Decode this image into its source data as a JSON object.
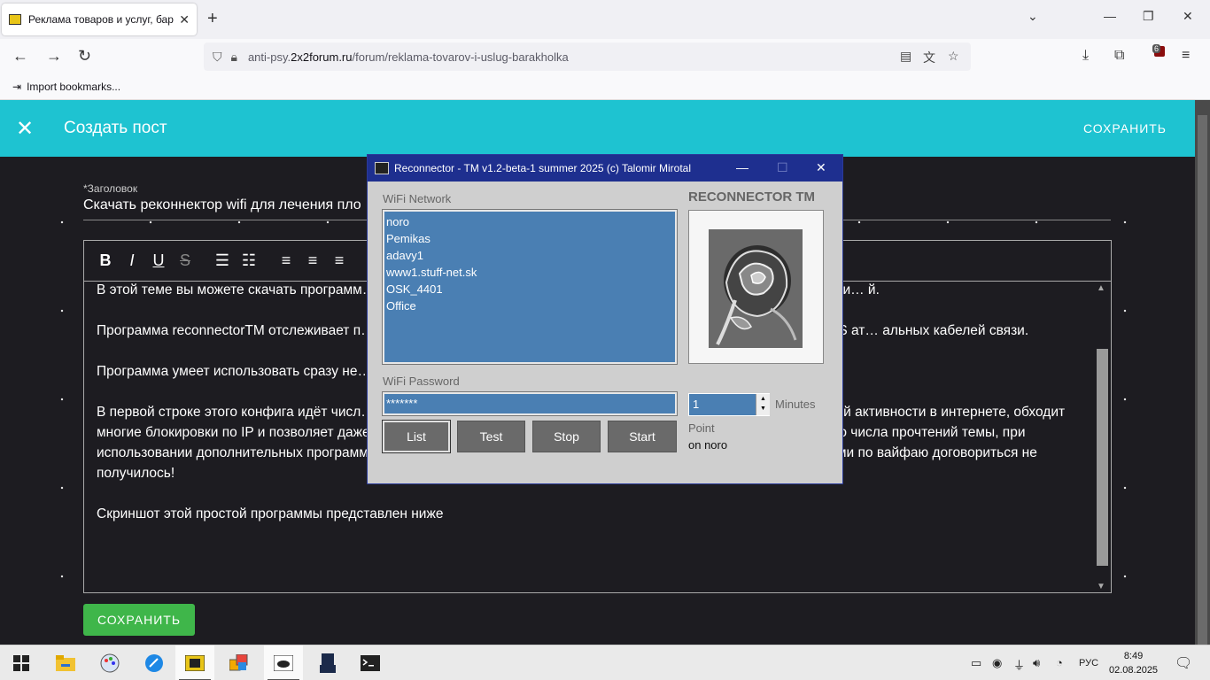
{
  "browser": {
    "tab_title": "Реклама товаров и услуг, бара",
    "url_prefix": "anti-psy.",
    "url_host": "2x2forum.ru",
    "url_path": "/forum/reklama-tovarov-i-uslug-barakholka",
    "bookmarks_import": "Import bookmarks...",
    "extension_badge": "6"
  },
  "appbar": {
    "title": "Создать пост",
    "save_label": "СОХРАНИТЬ"
  },
  "form": {
    "title_label": "*Заголовок",
    "title_value": "Скачать реконнектор wifi для лечения пло",
    "paragraphs": [
      "В этой теме вы можете скачать программ… екта в цикле при пропаже wifi на Windows. Также в этой теме могут публи… й.",
      "Программа reconnectorTM отслеживает п… й, в цикле, чтобы минимизировать неудобства при помехах, браке, DDoS ат… альных кабелей связи.",
      "Программа умеет использовать сразу не… пароль по одной в строке, начиная со второй строки файла config.txt",
      "В первой строке этого конфига идёт числ… ны IP адреса этим. Это уменьшает отслеживаетмость вас, компа и вашей активности в интернете, обходит многие блокировки по IP и позволяет даже продвигать темы форумов в топы поисковых систем имитацией большого числа прочтений темы, при использовании дополнительных программ. Умеет брутить вайфаи по включённым словарям паролей, если с соедями по вайфаю договориться не получилось!",
      "Скриншот этой простой программы представлен ниже"
    ],
    "save_button": "СОХРАНИТЬ"
  },
  "reconnector": {
    "window_title": "Reconnector - TM  v1.2-beta-1  summer 2025  (c) Talomir Mirotal",
    "brand": "RECONNECTOR TM",
    "wifi_network_label": "WiFi Network",
    "networks": [
      "noro",
      "Pemikas",
      "adavy1",
      "www1.stuff-net.sk",
      "OSK_4401",
      "Office"
    ],
    "wifi_password_label": "WiFi Password",
    "password_value": "*******",
    "interval_value": "1",
    "interval_unit": "Minutes",
    "buttons": {
      "list": "List",
      "test": "Test",
      "stop": "Stop",
      "start": "Start"
    },
    "point_label": "Point",
    "point_value": "on noro"
  },
  "taskbar": {
    "language": "РУС",
    "time": "8:49",
    "date": "02.08.2025"
  }
}
